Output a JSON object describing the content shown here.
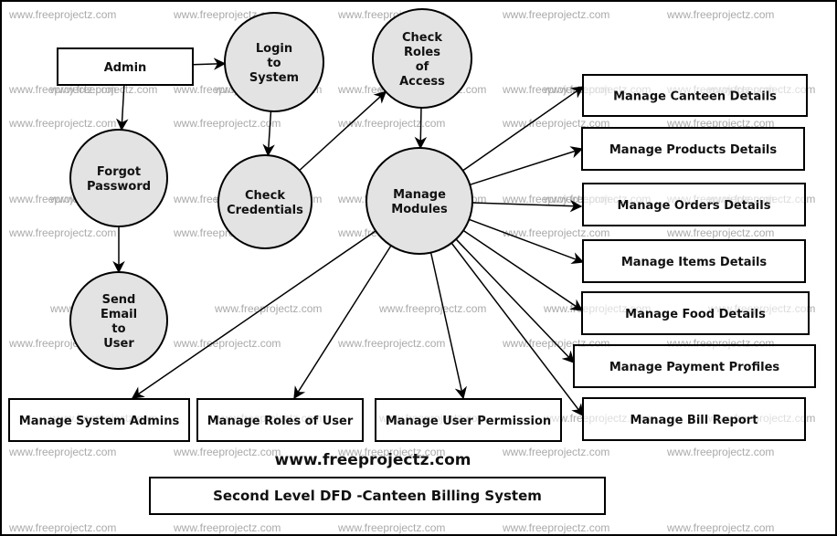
{
  "diagram": {
    "title": "Second Level DFD -Canteen Billing System",
    "website": "www.freeprojectz.com",
    "watermark": "www.freeprojectz.com",
    "colors": {
      "process_fill": "#e3e3e3",
      "stroke": "#000000",
      "watermark": "#aaaaaa"
    },
    "entities": [
      {
        "id": "admin",
        "label": "Admin"
      },
      {
        "id": "canteen",
        "label": "Manage Canteen Details"
      },
      {
        "id": "products",
        "label": "Manage Products Details"
      },
      {
        "id": "orders",
        "label": "Manage Orders Details"
      },
      {
        "id": "items",
        "label": "Manage Items Details"
      },
      {
        "id": "food",
        "label": "Manage Food Details"
      },
      {
        "id": "payment",
        "label": "Manage Payment Profiles"
      },
      {
        "id": "bill",
        "label": "Manage Bill Report"
      },
      {
        "id": "sysadmins",
        "label": "Manage System Admins"
      },
      {
        "id": "roles",
        "label": "Manage Roles of User"
      },
      {
        "id": "perm",
        "label": "Manage User Permission"
      }
    ],
    "processes": [
      {
        "id": "login",
        "lines": [
          "Login",
          "to",
          "System"
        ]
      },
      {
        "id": "checkroles",
        "lines": [
          "Check",
          "Roles",
          "of",
          "Access"
        ]
      },
      {
        "id": "forgot",
        "lines": [
          "Forgot",
          "Password"
        ]
      },
      {
        "id": "checkcred",
        "lines": [
          "Check",
          "Credentials"
        ]
      },
      {
        "id": "modules",
        "lines": [
          "Manage",
          "Modules"
        ]
      },
      {
        "id": "sendemail",
        "lines": [
          "Send",
          "Email",
          "to",
          "User"
        ]
      }
    ],
    "flows": [
      [
        "admin",
        "login"
      ],
      [
        "admin",
        "forgot"
      ],
      [
        "forgot",
        "sendemail"
      ],
      [
        "login",
        "checkcred"
      ],
      [
        "checkcred",
        "checkroles"
      ],
      [
        "checkroles",
        "modules"
      ],
      [
        "modules",
        "canteen"
      ],
      [
        "modules",
        "products"
      ],
      [
        "modules",
        "orders"
      ],
      [
        "modules",
        "items"
      ],
      [
        "modules",
        "food"
      ],
      [
        "modules",
        "payment"
      ],
      [
        "modules",
        "bill"
      ],
      [
        "modules",
        "sysadmins"
      ],
      [
        "modules",
        "roles"
      ],
      [
        "modules",
        "perm"
      ]
    ]
  }
}
